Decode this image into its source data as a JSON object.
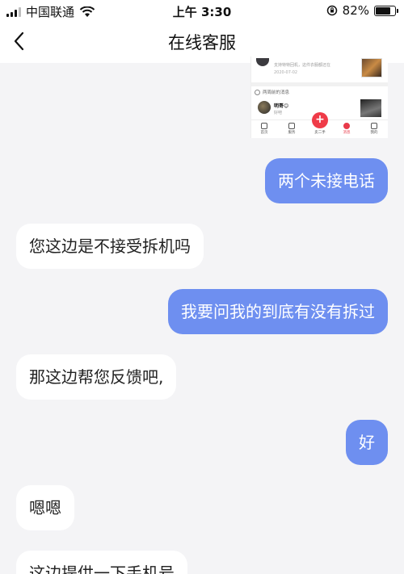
{
  "status_bar": {
    "carrier": "中国联通",
    "time": "上午 3:30",
    "battery": "82%"
  },
  "header": {
    "title": "在线客服",
    "back_icon": "chevron-left-icon"
  },
  "image_message": {
    "row1_text": "支持特特回机，这件衣服都还在",
    "row1_date": "2020-07-02",
    "section_label": "两周前的消息",
    "contact_name": "明哥😊",
    "contact_sub": "好吧",
    "tabs": [
      {
        "label": "首页"
      },
      {
        "label": "服务"
      },
      {
        "label": "卖二手"
      },
      {
        "label": "消息"
      },
      {
        "label": "我的"
      }
    ],
    "center_plus": "+"
  },
  "messages": [
    {
      "side": "out",
      "text": "两个未接电话"
    },
    {
      "side": "in",
      "text": "您这边是不接受拆机吗"
    },
    {
      "side": "out",
      "text": "我要问我的到底有没有拆过"
    },
    {
      "side": "in",
      "text": "那这边帮您反馈吧,"
    },
    {
      "side": "out",
      "text": "好"
    },
    {
      "side": "in",
      "text": "嗯嗯"
    },
    {
      "side": "in",
      "text": "这边提供一下手机号"
    }
  ],
  "colors": {
    "outgoing_bubble": "#6e8ff0",
    "incoming_bubble": "#ffffff",
    "background": "#f4f4f6",
    "accent_red": "#ef3b48"
  }
}
